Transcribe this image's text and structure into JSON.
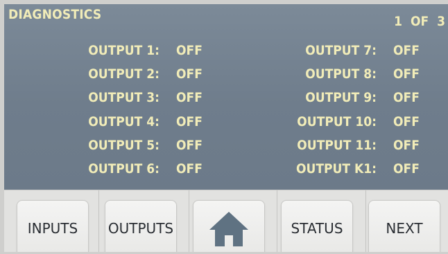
{
  "header": {
    "title": "DIAGNOSTICS",
    "page_indicator": "1 OF 3"
  },
  "outputs_left": [
    {
      "label": "OUTPUT 1:",
      "value": "OFF"
    },
    {
      "label": "OUTPUT 2:",
      "value": "OFF"
    },
    {
      "label": "OUTPUT 3:",
      "value": "OFF"
    },
    {
      "label": "OUTPUT 4:",
      "value": "OFF"
    },
    {
      "label": "OUTPUT 5:",
      "value": "OFF"
    },
    {
      "label": "OUTPUT 6:",
      "value": "OFF"
    }
  ],
  "outputs_right": [
    {
      "label": "OUTPUT 7:",
      "value": "OFF"
    },
    {
      "label": "OUTPUT 8:",
      "value": "OFF"
    },
    {
      "label": "OUTPUT 9:",
      "value": "OFF"
    },
    {
      "label": "OUTPUT 10:",
      "value": "OFF"
    },
    {
      "label": "OUTPUT 11:",
      "value": "OFF"
    },
    {
      "label": "OUTPUT K1:",
      "value": "OFF"
    }
  ],
  "nav": {
    "inputs_label": "INPUTS",
    "outputs_label": "OUTPUTS",
    "home_icon": "home-icon",
    "status_label": "STATUS",
    "next_label": "NEXT"
  },
  "colors": {
    "screen_bg": "#748391",
    "text": "#f1ecb8",
    "button_bg": "#eeeeec",
    "home_icon": "#5f7282"
  }
}
